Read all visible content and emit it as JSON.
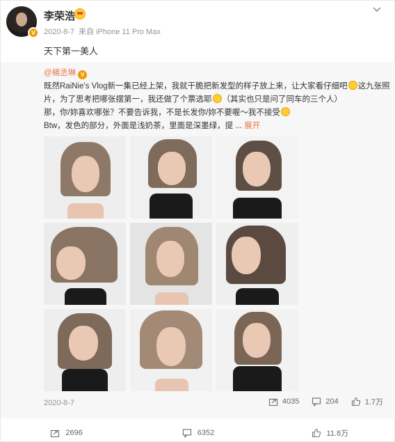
{
  "post": {
    "author": "李荣浩",
    "date": "2020-8-7",
    "source": "来自 iPhone 11 Pro Max",
    "text": "天下第一美人"
  },
  "repost": {
    "author": "@楊丞琳",
    "line1": "既然RaiNie's Vlog新一集已经上架，我就干脆把新发型的样子放上来，让大家看仔细吧",
    "line1b": "这九张照",
    "line2": "片，为了思考把哪张摆第一，我还做了个票选耶",
    "line2b": "（其实也只是问了同车的三个人）",
    "line3": "那，你/妳喜欢哪张？不要告诉我，不是长发你/妳不要喔～我不接受",
    "line4": "Btw，发色的部分，外面是浅奶茶，里面是深墨绿，提 ...",
    "expand": "展开",
    "date": "2020-8-7",
    "shares": "4035",
    "comments": "204",
    "likes": "1.7万"
  },
  "actions": {
    "shares": "2696",
    "comments": "6352",
    "likes": "11.8万"
  },
  "icons": [
    "chevron-down-icon",
    "share-icon",
    "comment-icon",
    "like-icon",
    "verified-badge-icon"
  ],
  "colors": {
    "link": "#eb7350",
    "verified": "#f49a00",
    "meta": "#939393"
  }
}
